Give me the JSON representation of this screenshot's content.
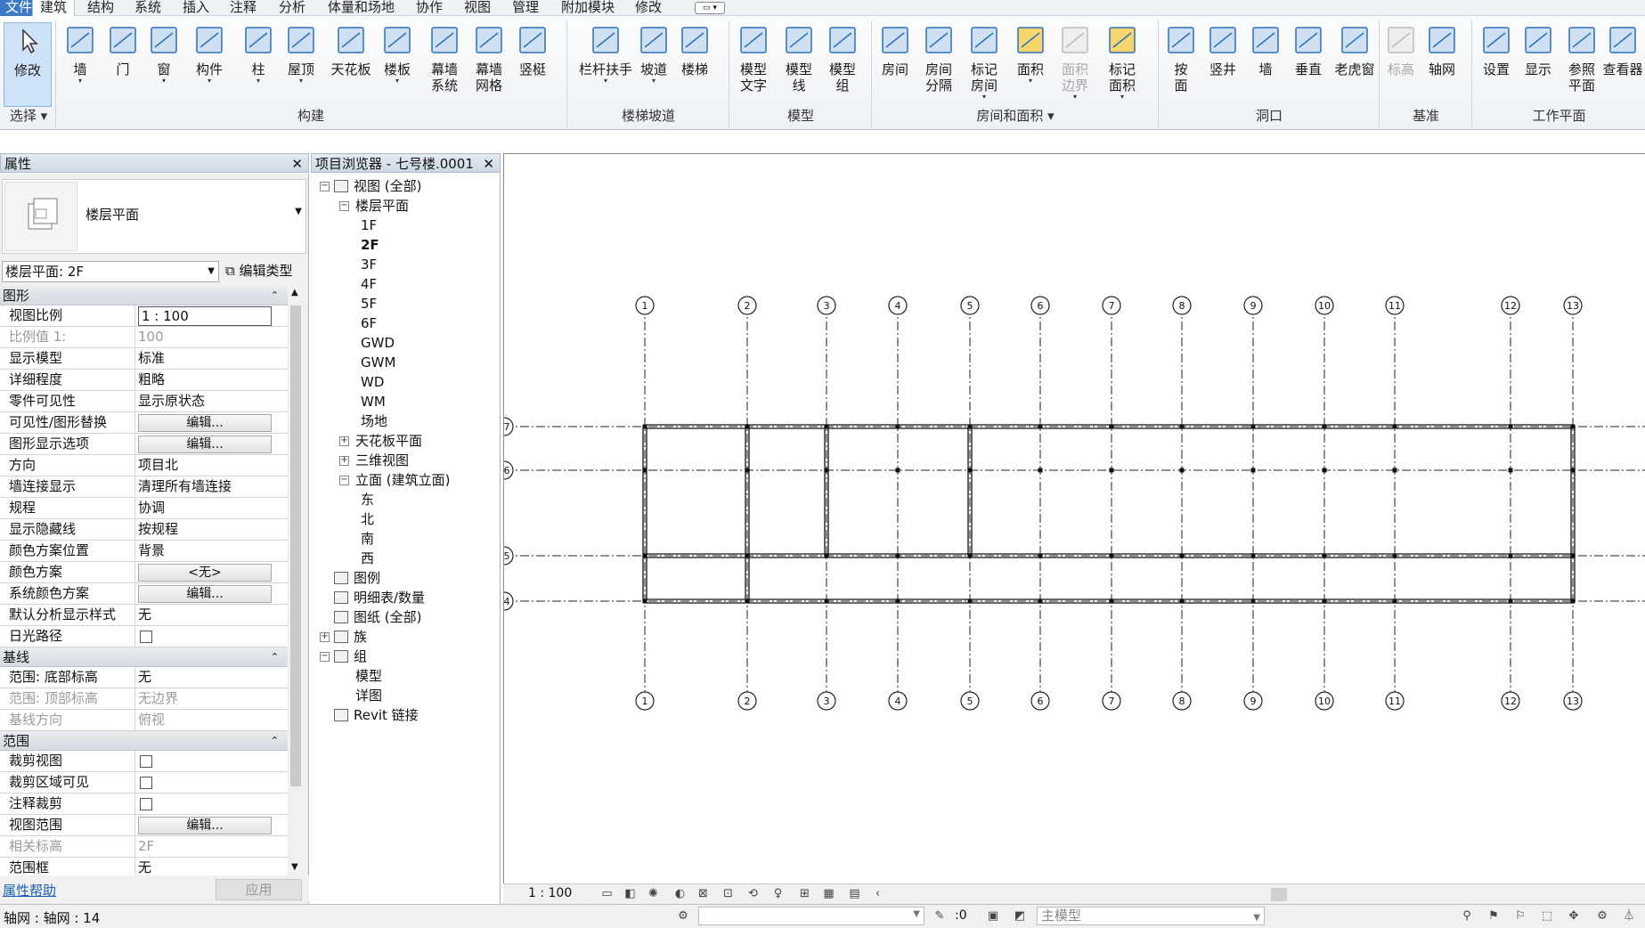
{
  "tabs": {
    "file": "文件",
    "items": [
      "建筑",
      "结构",
      "系统",
      "插入",
      "注释",
      "分析",
      "体量和场地",
      "协作",
      "视图",
      "管理",
      "附加模块",
      "修改"
    ],
    "active_index": 0
  },
  "ribbon": {
    "buttons": [
      {
        "label": "修改",
        "icon": "select-cursor-icon"
      },
      {
        "label": "墙",
        "icon": "wall-icon"
      },
      {
        "label": "门",
        "icon": "door-icon"
      },
      {
        "label": "窗",
        "icon": "window-icon"
      },
      {
        "label": "构件",
        "icon": "component-icon"
      },
      {
        "label": "柱",
        "icon": "column-icon"
      },
      {
        "label": "屋顶",
        "icon": "roof-icon"
      },
      {
        "label": "天花板",
        "icon": "ceiling-icon"
      },
      {
        "label": "楼板",
        "icon": "floor-icon"
      },
      {
        "label": "幕墙\n系统",
        "icon": "curtain-system-icon"
      },
      {
        "label": "幕墙\n网格",
        "icon": "curtain-grid-icon"
      },
      {
        "label": "竖梃",
        "icon": "mullion-icon"
      },
      {
        "label": "栏杆扶手",
        "icon": "railing-icon"
      },
      {
        "label": "坡道",
        "icon": "ramp-icon"
      },
      {
        "label": "楼梯",
        "icon": "stair-icon"
      },
      {
        "label": "模型\n文字",
        "icon": "model-text-icon"
      },
      {
        "label": "模型\n线",
        "icon": "model-line-icon"
      },
      {
        "label": "模型\n组",
        "icon": "model-group-icon"
      },
      {
        "label": "房间",
        "icon": "room-icon"
      },
      {
        "label": "房间\n分隔",
        "icon": "room-separator-icon"
      },
      {
        "label": "标记\n房间",
        "icon": "tag-room-icon"
      },
      {
        "label": "面积",
        "icon": "area-icon"
      },
      {
        "label": "面积\n边界",
        "icon": "area-boundary-icon"
      },
      {
        "label": "标记\n面积",
        "icon": "tag-area-icon"
      },
      {
        "label": "按\n面",
        "icon": "opening-by-face-icon"
      },
      {
        "label": "竖井",
        "icon": "shaft-icon"
      },
      {
        "label": "墙",
        "icon": "wall-opening-icon"
      },
      {
        "label": "垂直",
        "icon": "vertical-opening-icon"
      },
      {
        "label": "老虎窗",
        "icon": "dormer-icon"
      },
      {
        "label": "标高",
        "icon": "level-icon"
      },
      {
        "label": "轴网",
        "icon": "grid-icon"
      },
      {
        "label": "设置",
        "icon": "set-workplane-icon"
      },
      {
        "label": "显示",
        "icon": "show-workplane-icon"
      },
      {
        "label": "参照\n平面",
        "icon": "ref-plane-icon"
      },
      {
        "label": "查看器",
        "icon": "viewer-icon"
      }
    ],
    "groups": [
      "选择",
      "构建",
      "楼梯坡道",
      "模型",
      "房间和面积",
      "洞口",
      "基准",
      "工作平面"
    ]
  },
  "properties": {
    "title": "属性",
    "type_name": "楼层平面",
    "instance": "楼层平面: 2F",
    "edit_type": "编辑类型",
    "sections": [
      {
        "name": "图形",
        "rows": [
          {
            "k": "视图比例",
            "v": "1 : 100",
            "kind": "input"
          },
          {
            "k": "比例值 1:",
            "v": "100",
            "kind": "gray"
          },
          {
            "k": "显示模型",
            "v": "标准"
          },
          {
            "k": "详细程度",
            "v": "粗略"
          },
          {
            "k": "零件可见性",
            "v": "显示原状态"
          },
          {
            "k": "可见性/图形替换",
            "v": "编辑...",
            "kind": "button"
          },
          {
            "k": "图形显示选项",
            "v": "编辑...",
            "kind": "button"
          },
          {
            "k": "方向",
            "v": "项目北"
          },
          {
            "k": "墙连接显示",
            "v": "清理所有墙连接"
          },
          {
            "k": "规程",
            "v": "协调"
          },
          {
            "k": "显示隐藏线",
            "v": "按规程"
          },
          {
            "k": "颜色方案位置",
            "v": "背景"
          },
          {
            "k": "颜色方案",
            "v": "<无>",
            "kind": "button"
          },
          {
            "k": "系统颜色方案",
            "v": "编辑...",
            "kind": "button"
          },
          {
            "k": "默认分析显示样式",
            "v": "无"
          },
          {
            "k": "日光路径",
            "v": "",
            "kind": "check"
          }
        ]
      },
      {
        "name": "基线",
        "rows": [
          {
            "k": "范围: 底部标高",
            "v": "无"
          },
          {
            "k": "范围: 顶部标高",
            "v": "无边界",
            "kind": "gray"
          },
          {
            "k": "基线方向",
            "v": "俯视",
            "kind": "gray"
          }
        ]
      },
      {
        "name": "范围",
        "rows": [
          {
            "k": "裁剪视图",
            "v": "",
            "kind": "check"
          },
          {
            "k": "裁剪区域可见",
            "v": "",
            "kind": "check"
          },
          {
            "k": "注释裁剪",
            "v": "",
            "kind": "check"
          },
          {
            "k": "视图范围",
            "v": "编辑...",
            "kind": "button"
          },
          {
            "k": "相关标高",
            "v": "2F",
            "kind": "gray"
          },
          {
            "k": "范围框",
            "v": "无"
          }
        ]
      }
    ],
    "help": "属性帮助",
    "apply": "应用"
  },
  "browser": {
    "title": "项目浏览器 - 七号楼.0001",
    "nodes": [
      {
        "label": "视图 (全部)",
        "level": 0,
        "box": "−",
        "icon": true
      },
      {
        "label": "楼层平面",
        "level": 1,
        "box": "−"
      },
      {
        "label": "1F",
        "level": 2
      },
      {
        "label": "2F",
        "level": 2,
        "bold": true
      },
      {
        "label": "3F",
        "level": 2
      },
      {
        "label": "4F",
        "level": 2
      },
      {
        "label": "5F",
        "level": 2
      },
      {
        "label": "6F",
        "level": 2
      },
      {
        "label": "GWD",
        "level": 2
      },
      {
        "label": "GWM",
        "level": 2
      },
      {
        "label": "WD",
        "level": 2
      },
      {
        "label": "WM",
        "level": 2
      },
      {
        "label": "场地",
        "level": 2
      },
      {
        "label": "天花板平面",
        "level": 1,
        "box": "+"
      },
      {
        "label": "三维视图",
        "level": 1,
        "box": "+"
      },
      {
        "label": "立面 (建筑立面)",
        "level": 1,
        "box": "−"
      },
      {
        "label": "东",
        "level": 2
      },
      {
        "label": "北",
        "level": 2
      },
      {
        "label": "南",
        "level": 2
      },
      {
        "label": "西",
        "level": 2
      },
      {
        "label": "图例",
        "level": 0,
        "icon": true
      },
      {
        "label": "明细表/数量",
        "level": 0,
        "icon": true
      },
      {
        "label": "图纸 (全部)",
        "level": 0,
        "icon": true
      },
      {
        "label": "族",
        "level": 0,
        "box": "+",
        "icon": true
      },
      {
        "label": "组",
        "level": 0,
        "box": "−",
        "icon": true
      },
      {
        "label": "模型",
        "level": 1
      },
      {
        "label": "详图",
        "level": 1
      },
      {
        "label": "Revit 链接",
        "level": 0,
        "icon": true
      }
    ]
  },
  "grids": {
    "vertical": [
      "1",
      "2",
      "3",
      "4",
      "5",
      "6",
      "7",
      "8",
      "9",
      "10",
      "11",
      "12",
      "13"
    ],
    "horizontal": [
      "7",
      "6",
      "5",
      "4"
    ]
  },
  "viewbar": {
    "scale": "1 : 100"
  },
  "status": {
    "text": "轴网 : 轴网 : 14",
    "zero": ":0",
    "model": "主模型"
  }
}
